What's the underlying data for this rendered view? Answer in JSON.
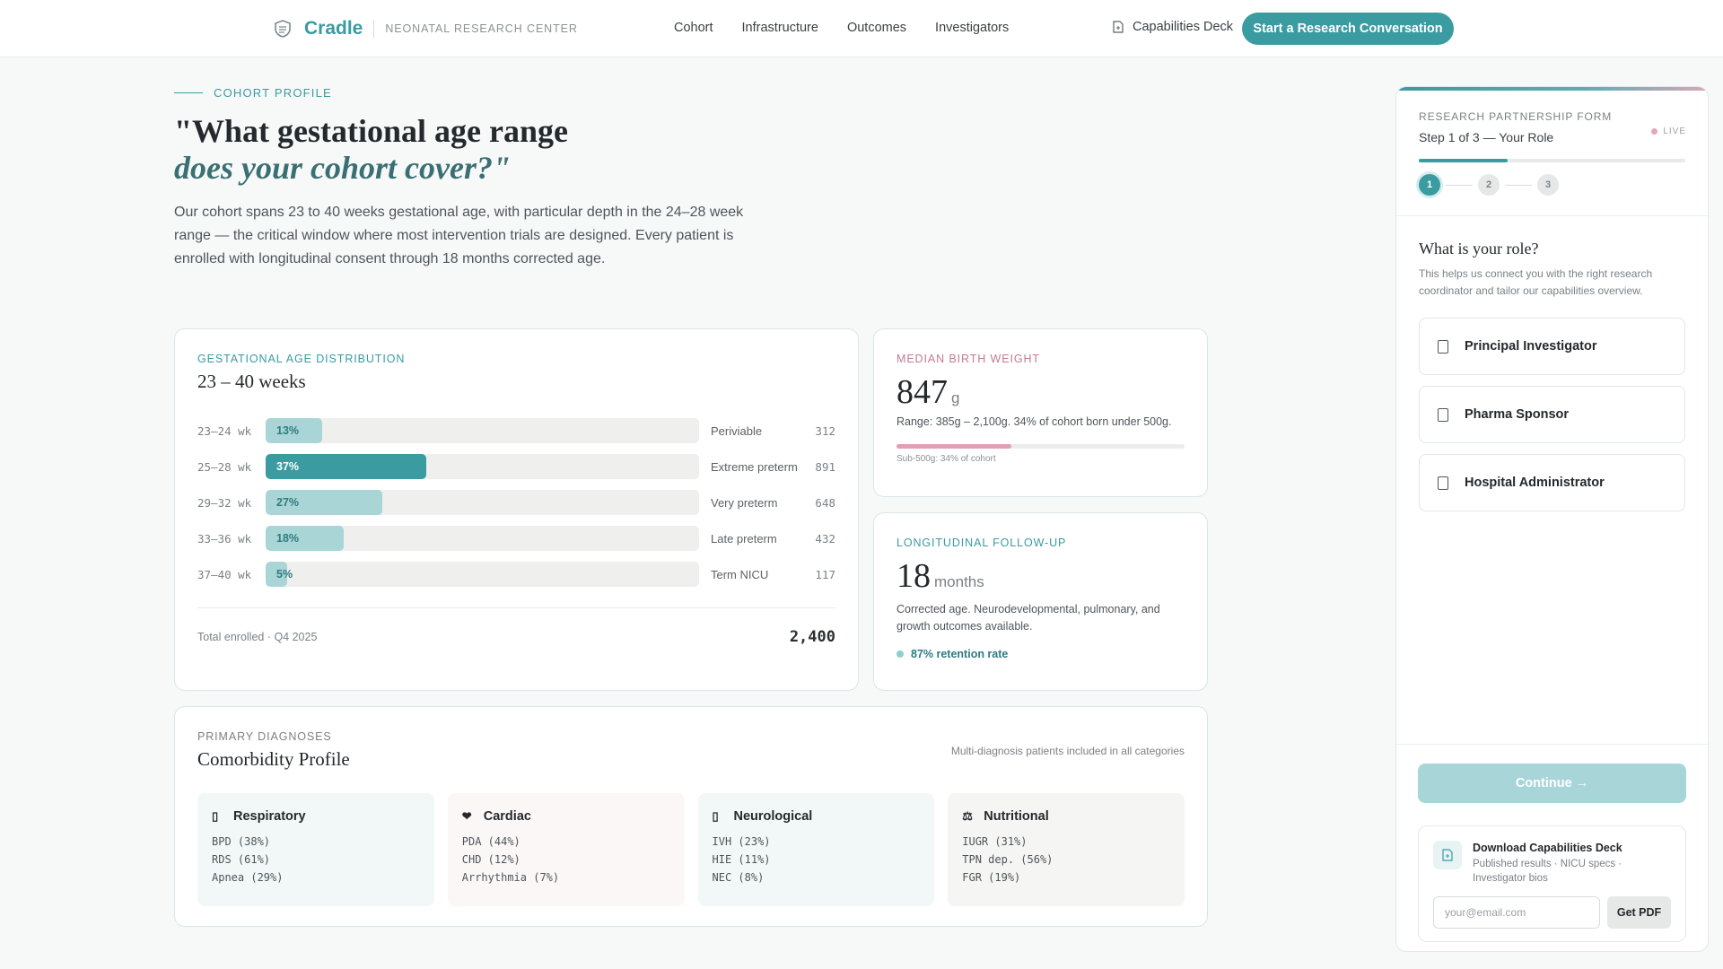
{
  "nav": {
    "brand": "Cradle",
    "brand_sub": "NEONATAL RESEARCH CENTER",
    "links": [
      "Cohort",
      "Infrastructure",
      "Outcomes",
      "Investigators"
    ],
    "deck_link": "Capabilities Deck",
    "cta": "Start a Research Conversation"
  },
  "hero": {
    "eyebrow": "COHORT PROFILE",
    "title_line1": "\"What gestational age range",
    "title_line2": "does your cohort cover?\"",
    "lede": "Our cohort spans 23 to 40 weeks gestational age, with particular depth in the 24–28 week range — the critical window where most intervention trials are designed. Every patient is enrolled with longitudinal consent through 18 months corrected age."
  },
  "distribution": {
    "eyebrow": "GESTATIONAL AGE DISTRIBUTION",
    "title": "23 – 40 weeks",
    "rows": [
      {
        "range": "23–24 wk",
        "pct_label": "13%",
        "pct": 13,
        "label": "Periviable",
        "count": "312"
      },
      {
        "range": "25–28 wk",
        "pct_label": "37%",
        "pct": 37,
        "label": "Extreme preterm",
        "count": "891"
      },
      {
        "range": "29–32 wk",
        "pct_label": "27%",
        "pct": 27,
        "label": "Very preterm",
        "count": "648"
      },
      {
        "range": "33–36 wk",
        "pct_label": "18%",
        "pct": 18,
        "label": "Late preterm",
        "count": "432"
      },
      {
        "range": "37–40 wk",
        "pct_label": "5%",
        "pct": 5,
        "label": "Term NICU",
        "count": "117"
      }
    ],
    "footer_label": "Total enrolled · Q4 2025",
    "footer_total": "2,400",
    "colors": {
      "highlight": "#3a9ba1",
      "default": "#a9d5d6"
    }
  },
  "birth_weight": {
    "eyebrow": "MEDIAN BIRTH WEIGHT",
    "value": "847",
    "unit": "g",
    "desc": "Range: 385g – 2,100g. 34% of cohort born under 500g.",
    "bar_fraction": 0.4,
    "note": "Sub-500g: 34% of cohort"
  },
  "followup": {
    "eyebrow": "LONGITUDINAL FOLLOW-UP",
    "value": "18",
    "unit": "months",
    "desc": "Corrected age. Neurodevelopmental, pulmonary, and growth outcomes available.",
    "retention": "87% retention rate"
  },
  "diagnoses": {
    "eyebrow": "PRIMARY DIAGNOSES",
    "title": "Comorbidity Profile",
    "aside": "Multi-diagnosis patients included in all categories",
    "groups": [
      {
        "icon": "lungs-icon",
        "glyph": "▯",
        "name": "Respiratory",
        "bg": "#f1f8f7",
        "items": [
          "BPD (38%)",
          "RDS (61%)",
          "Apnea (29%)"
        ]
      },
      {
        "icon": "heart-icon",
        "glyph": "❤",
        "name": "Cardiac",
        "bg": "#fcf7f7",
        "items": [
          "PDA (44%)",
          "CHD (12%)",
          "Arrhythmia (7%)"
        ]
      },
      {
        "icon": "brain-icon",
        "glyph": "▯",
        "name": "Neurological",
        "bg": "#f1f8f7",
        "items": [
          "IVH (23%)",
          "HIE (11%)",
          "NEC (8%)"
        ]
      },
      {
        "icon": "scale-icon",
        "glyph": "⚖",
        "name": "Nutritional",
        "bg": "#f5f5f3",
        "items": [
          "IUGR (31%)",
          "TPN dep. (56%)",
          "FGR (19%)"
        ]
      }
    ]
  },
  "panel": {
    "eyebrow": "RESEARCH PARTNERSHIP FORM",
    "live": "LIVE",
    "step": "Step 1 of 3 — Your Role",
    "progress_fraction": 0.333,
    "steps": [
      "1",
      "2",
      "3"
    ],
    "question": "What is your role?",
    "question_desc": "This helps us connect you with the right research coordinator and tailor our capabilities overview.",
    "options": [
      "Principal Investigator",
      "Pharma Sponsor",
      "Hospital Administrator"
    ],
    "continue": "Continue →",
    "download_title": "Download Capabilities Deck",
    "download_sub": "Published results · NICU specs · Investigator bios",
    "email_placeholder": "your@email.com",
    "get_pdf": "Get PDF"
  }
}
